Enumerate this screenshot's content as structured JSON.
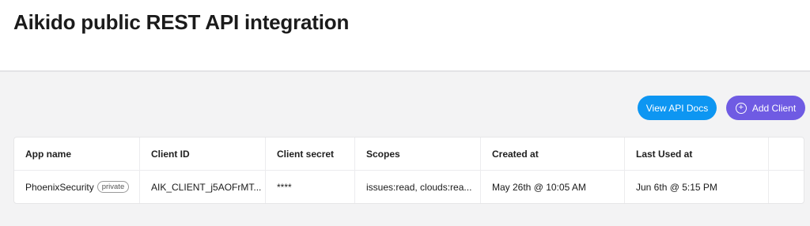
{
  "page": {
    "title": "Aikido public REST API integration"
  },
  "actions": {
    "view_docs_label": "View API Docs",
    "add_client_label": "Add Client"
  },
  "icons": {
    "add": "plus-circle-icon"
  },
  "table": {
    "headers": [
      "App name",
      "Client ID",
      "Client secret",
      "Scopes",
      "Created at",
      "Last Used at",
      ""
    ],
    "rows": [
      {
        "app_name": "PhoenixSecurity",
        "badge": "private",
        "client_id": "AIK_CLIENT_j5AOFrMT...",
        "client_secret": "****",
        "scopes": "issues:read, clouds:rea...",
        "created_at": "May 26th @ 10:05 AM",
        "last_used_at": "Jun 6th @ 5:15 PM"
      }
    ]
  },
  "colors": {
    "view_docs_bg": "#0d96f2",
    "add_client_bg": "#6f5be3",
    "content_bg": "#f3f3f4"
  }
}
